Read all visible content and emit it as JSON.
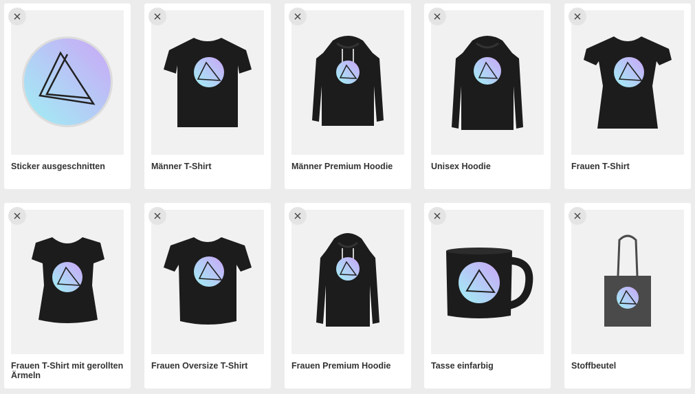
{
  "products": [
    {
      "name": "Sticker ausgeschnitten",
      "type": "sticker",
      "remove_icon": "close-icon"
    },
    {
      "name": "Männer T-Shirt",
      "type": "mens-tshirt",
      "remove_icon": "close-icon"
    },
    {
      "name": "Männer Premium Hoodie",
      "type": "mens-hoodie",
      "remove_icon": "close-icon"
    },
    {
      "name": "Unisex Hoodie",
      "type": "unisex-hoodie",
      "remove_icon": "close-icon"
    },
    {
      "name": "Frauen T-Shirt",
      "type": "womens-tshirt",
      "remove_icon": "close-icon"
    },
    {
      "name": "Frauen T-Shirt mit gerollten Ärmeln",
      "type": "rolled-sleeve-tshirt",
      "remove_icon": "close-icon"
    },
    {
      "name": "Frauen Oversize T-Shirt",
      "type": "oversize-tshirt",
      "remove_icon": "close-icon"
    },
    {
      "name": "Frauen Premium Hoodie",
      "type": "womens-hoodie",
      "remove_icon": "close-icon"
    },
    {
      "name": "Tasse einfarbig",
      "type": "mug",
      "remove_icon": "close-icon"
    },
    {
      "name": "Stoffbeutel",
      "type": "tote-bag",
      "remove_icon": "close-icon"
    }
  ],
  "colors": {
    "page_background": "#ececec",
    "card_background": "#ffffff",
    "thumb_background": "#f1f1f1",
    "garment": "#1c1c1c",
    "tote": "#4a4a4a",
    "label_text": "#333333"
  }
}
